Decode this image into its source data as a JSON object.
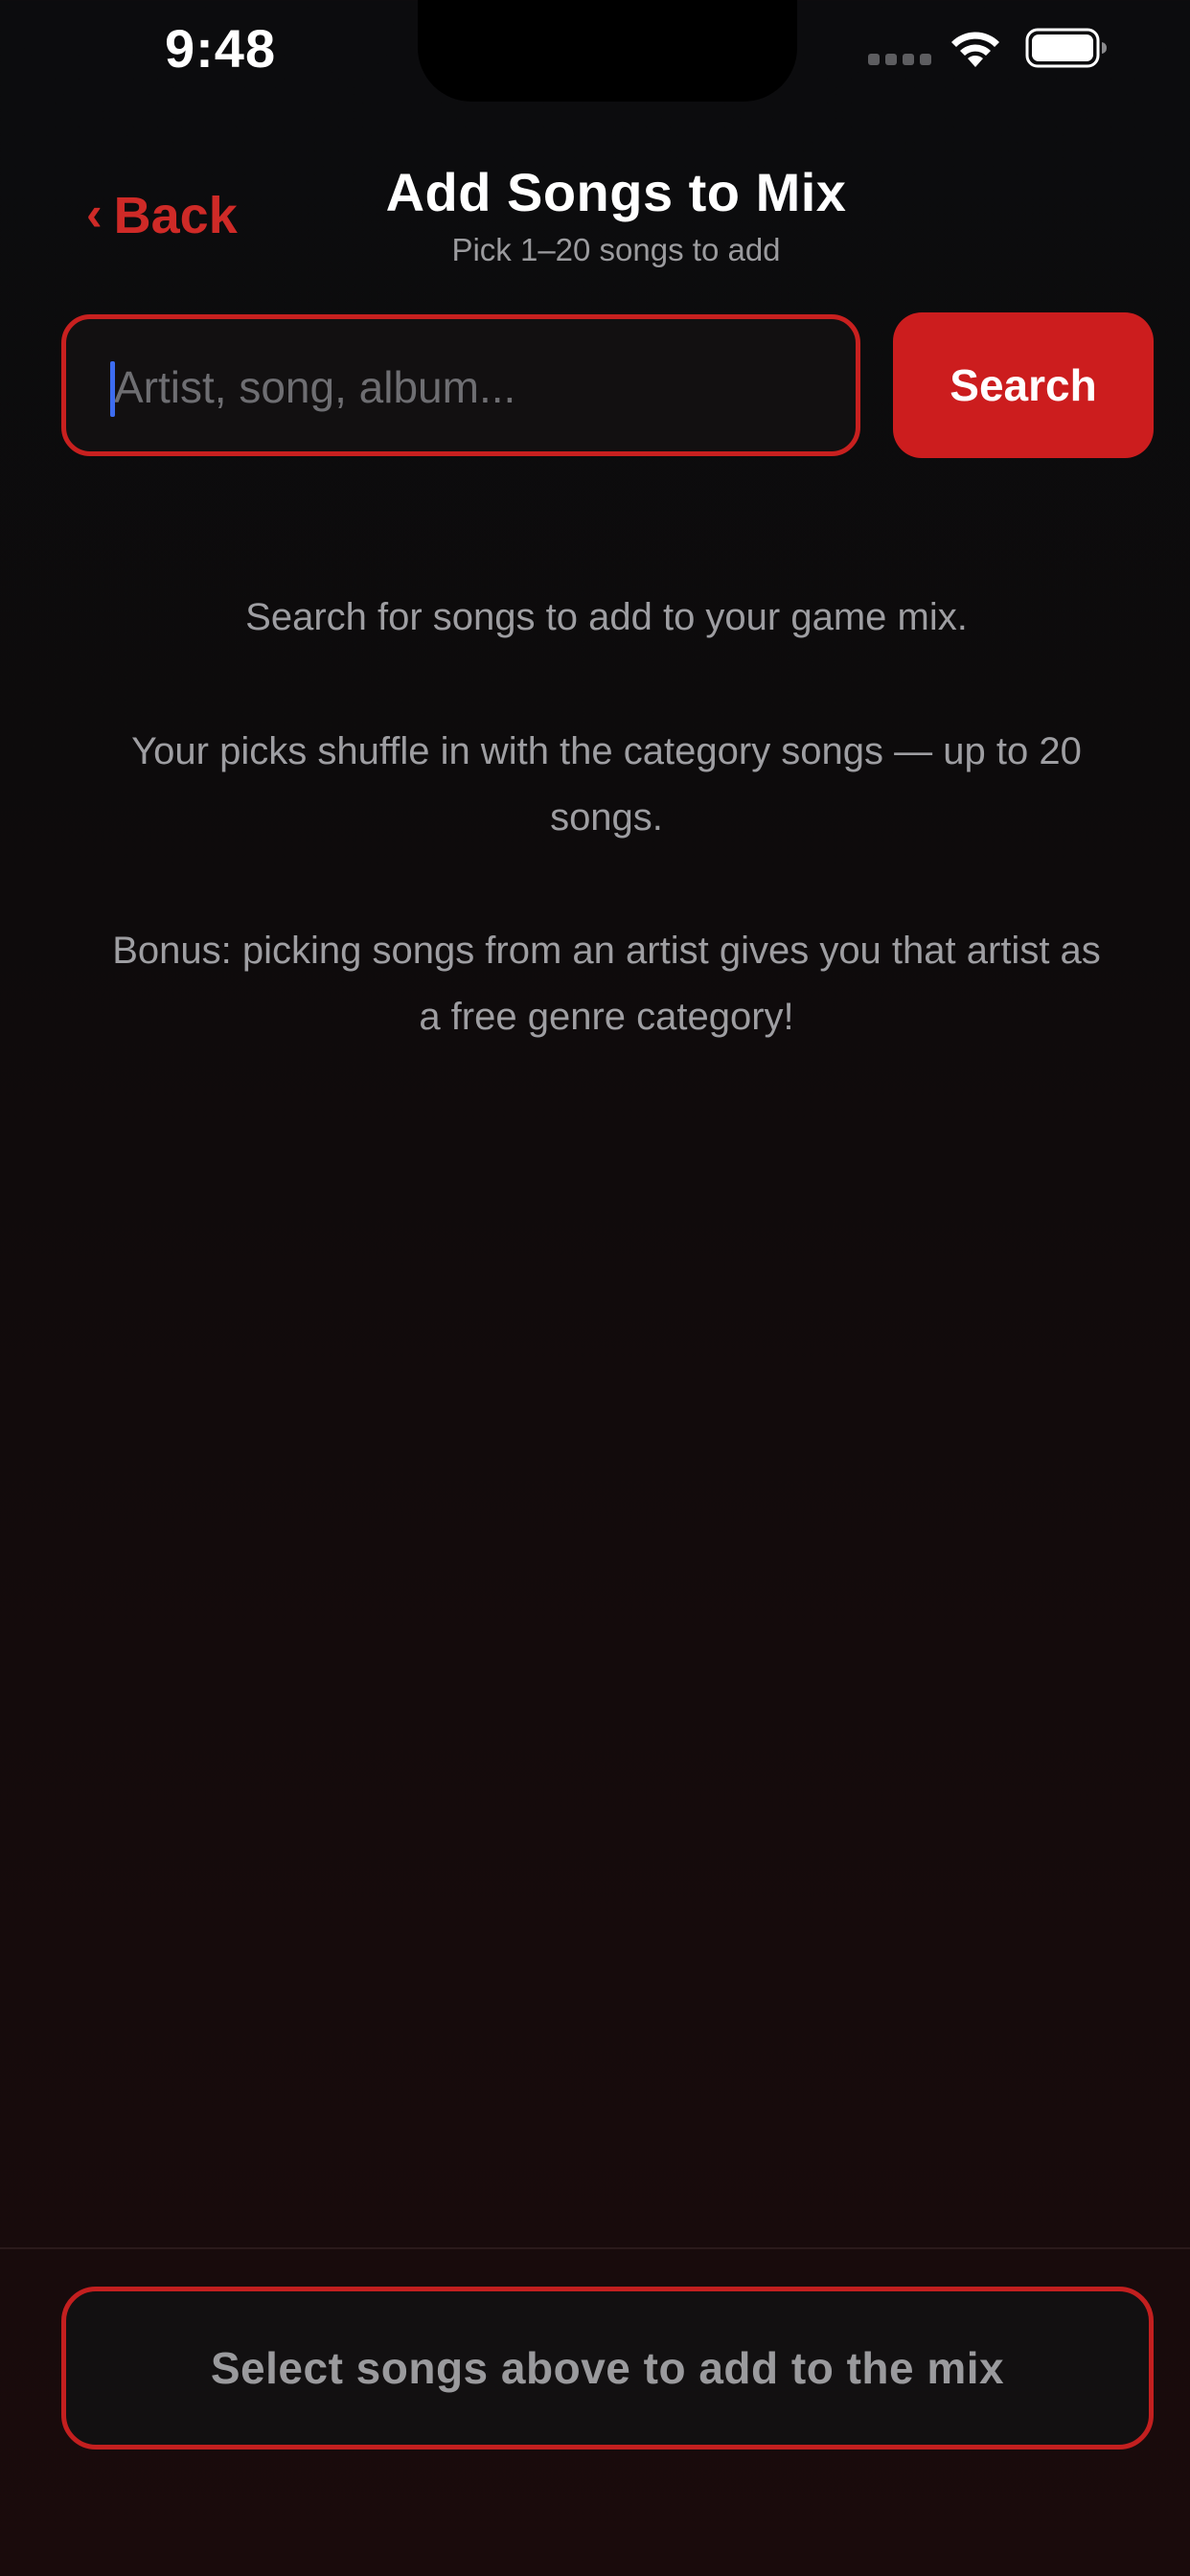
{
  "status_bar": {
    "time": "9:48",
    "icons": [
      "signal-dots-icon",
      "wifi-icon",
      "battery-icon"
    ]
  },
  "header": {
    "back_chevron": "‹",
    "back_label": "Back",
    "title": "Add Songs to Mix",
    "subtitle": "Pick 1–20 songs to add"
  },
  "search": {
    "value": "",
    "placeholder": "Artist, song, album...",
    "button_label": "Search"
  },
  "info": {
    "line_1": "Search for songs to add to your game mix.",
    "line_2": "Your picks shuffle in with the category songs — up to 20 songs.",
    "line_3": "Bonus: picking songs from an artist gives you that artist as a free genre category!"
  },
  "footer": {
    "button_label": "Select songs above to add to the mix"
  },
  "colors": {
    "accent": "#cc1d1e",
    "background_top": "#0c0c0e",
    "background_bottom": "#1a0b0c",
    "muted_text": "#9e9ea2",
    "caret": "#3d6cf0"
  }
}
